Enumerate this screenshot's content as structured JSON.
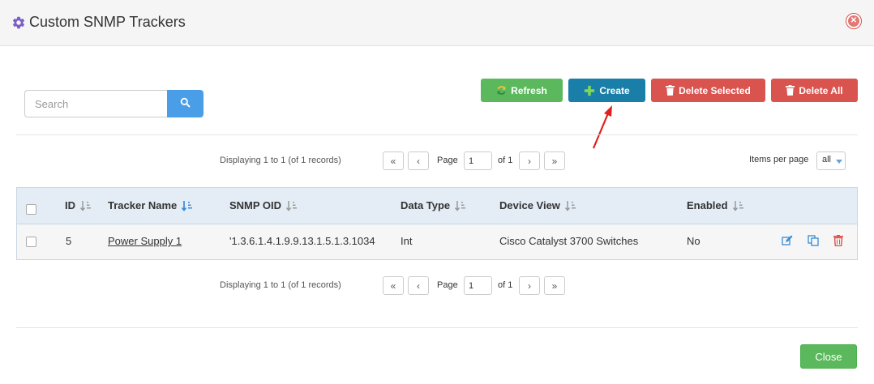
{
  "dialog": {
    "title": "Custom SNMP Trackers",
    "close_label": "Close"
  },
  "search": {
    "placeholder": "Search",
    "value": ""
  },
  "toolbar": {
    "refresh_label": "Refresh",
    "create_label": "Create",
    "delete_selected_label": "Delete Selected",
    "delete_all_label": "Delete All"
  },
  "pager": {
    "info": "Displaying 1 to 1 (of 1 records)",
    "page_label": "Page",
    "page_value": "1",
    "of_label": "of 1",
    "first": "«",
    "prev": "‹",
    "next": "›",
    "last": "»"
  },
  "items_per_page": {
    "label": "Items per page",
    "value": "all"
  },
  "table": {
    "columns": [
      "ID",
      "Tracker Name",
      "SNMP OID",
      "Data Type",
      "Device View",
      "Enabled"
    ],
    "rows": [
      {
        "id": "5",
        "tracker_name": "Power Supply 1",
        "snmp_oid": "'1.3.6.1.4.1.9.9.13.1.5.1.3.1034",
        "data_type": "Int",
        "device_view": "Cisco Catalyst 3700 Switches",
        "enabled": "No"
      }
    ]
  },
  "icons": {
    "title": "gear-icon",
    "close": "close-circle-icon",
    "search": "search-icon",
    "refresh": "refresh-icon",
    "create": "plus-icon",
    "delete": "trash-icon",
    "sort": "sort-icon",
    "edit": "edit-icon",
    "copy": "copy-icon"
  },
  "colors": {
    "accent_purple": "#7b5fc7",
    "success": "#5cb85c",
    "primary": "#1a7fa8",
    "danger": "#d9534f",
    "search": "#4a9ee8",
    "annotation_arrow": "#e0201c"
  }
}
